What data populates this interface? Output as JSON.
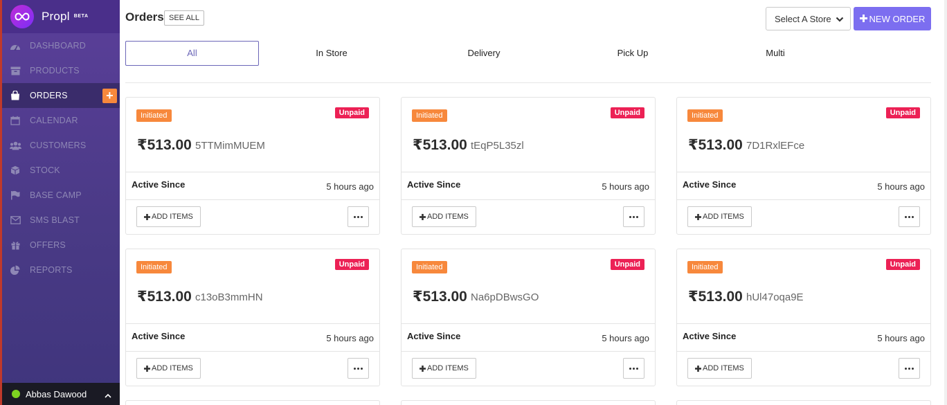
{
  "brand": {
    "name": "Propl",
    "badge": "BETA",
    "logo_icon": "infinity-icon"
  },
  "sidebar": {
    "items": [
      {
        "label": "DASHBOARD",
        "icon": "dashboard-icon"
      },
      {
        "label": "PRODUCTS",
        "icon": "archive-icon"
      },
      {
        "label": "ORDERS",
        "icon": "shopping-bag-icon",
        "active": true
      },
      {
        "label": "CALENDAR",
        "icon": "calendar-icon"
      },
      {
        "label": "CUSTOMERS",
        "icon": "users-icon"
      },
      {
        "label": "STOCK",
        "icon": "cube-icon"
      },
      {
        "label": "BASE CAMP",
        "icon": "flag-icon"
      },
      {
        "label": "SMS BLAST",
        "icon": "envelope-icon"
      },
      {
        "label": "OFFERS",
        "icon": "gift-icon"
      },
      {
        "label": "REPORTS",
        "icon": "pie-chart-icon"
      }
    ],
    "orders_add": "+",
    "user": {
      "name": "Abbas Dawood",
      "status_color": "#7ed321"
    }
  },
  "header": {
    "title": "Orders",
    "see_all": "SEE ALL",
    "store_select": "Select A Store",
    "new_order": "NEW ORDER"
  },
  "tabs": [
    "All",
    "In Store",
    "Delivery",
    "Pick Up",
    "Multi"
  ],
  "active_tab": "All",
  "orders": [
    {
      "status": "Initiated",
      "payment": "Unpaid",
      "amount": "₹513.00",
      "code": "5TTMimMUEM",
      "active_label": "Active Since",
      "active_time": "5 hours ago",
      "add_items": "ADD ITEMS"
    },
    {
      "status": "Initiated",
      "payment": "Unpaid",
      "amount": "₹513.00",
      "code": "tEqP5L35zl",
      "active_label": "Active Since",
      "active_time": "5 hours ago",
      "add_items": "ADD ITEMS"
    },
    {
      "status": "Initiated",
      "payment": "Unpaid",
      "amount": "₹513.00",
      "code": "7D1RxlEFce",
      "active_label": "Active Since",
      "active_time": "5 hours ago",
      "add_items": "ADD ITEMS"
    },
    {
      "status": "Initiated",
      "payment": "Unpaid",
      "amount": "₹513.00",
      "code": "c13oB3mmHN",
      "active_label": "Active Since",
      "active_time": "5 hours ago",
      "add_items": "ADD ITEMS"
    },
    {
      "status": "Initiated",
      "payment": "Unpaid",
      "amount": "₹513.00",
      "code": "Na6pDBwsGO",
      "active_label": "Active Since",
      "active_time": "5 hours ago",
      "add_items": "ADD ITEMS"
    },
    {
      "status": "Initiated",
      "payment": "Unpaid",
      "amount": "₹513.00",
      "code": "hUl47oqa9E",
      "active_label": "Active Since",
      "active_time": "5 hours ago",
      "add_items": "ADD ITEMS"
    }
  ],
  "colors": {
    "sidebar": "#4a3a86",
    "accent": "#7c6ef0",
    "status_initiated": "#f7883c",
    "payment_unpaid": "#ec2155"
  }
}
